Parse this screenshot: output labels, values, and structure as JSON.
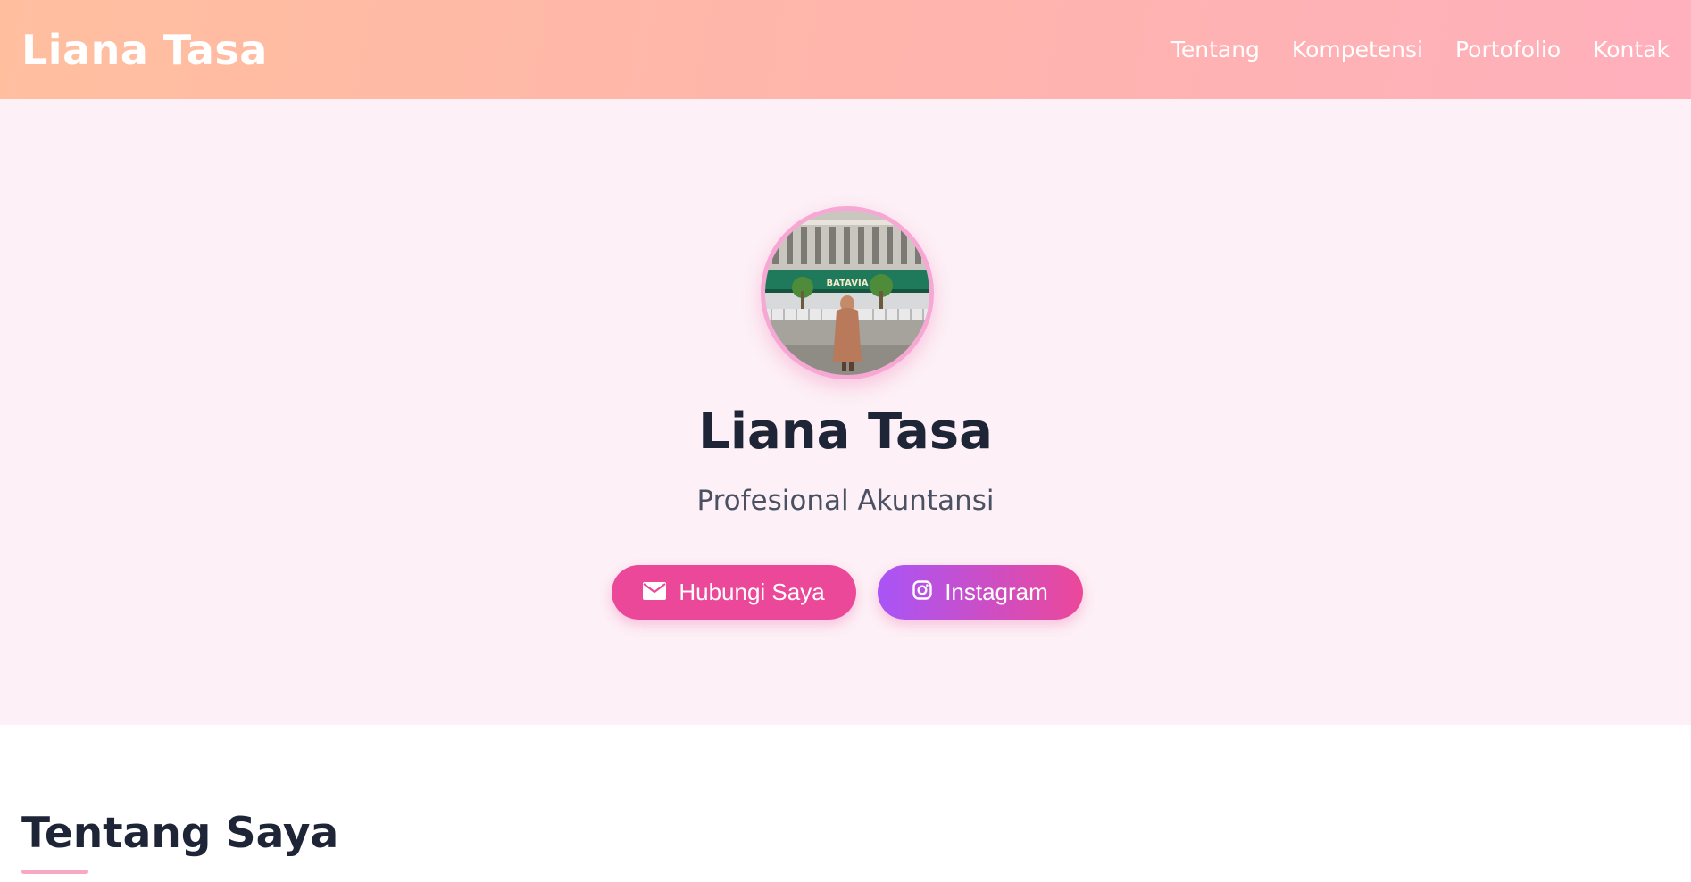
{
  "header": {
    "brand": "Liana Tasa",
    "nav": [
      {
        "label": "Tentang"
      },
      {
        "label": "Kompetensi"
      },
      {
        "label": "Portofolio"
      },
      {
        "label": "Kontak"
      }
    ]
  },
  "hero": {
    "avatar_sign": "BATAVIA",
    "name": "Liana Tasa",
    "role": "Profesional Akuntansi",
    "buttons": {
      "contact_label": "Hubungi Saya",
      "contact_icon": "envelope-icon",
      "instagram_label": "Instagram",
      "instagram_icon": "instagram-icon"
    }
  },
  "about": {
    "title": "Tentang Saya"
  },
  "colors": {
    "primary_pink": "#ec4899",
    "purple": "#a855f7",
    "hero_bg": "#fdf0f6",
    "heading": "#1e2536",
    "header_gradient_start": "#ffbf9f",
    "header_gradient_end": "#ffb0bd"
  }
}
